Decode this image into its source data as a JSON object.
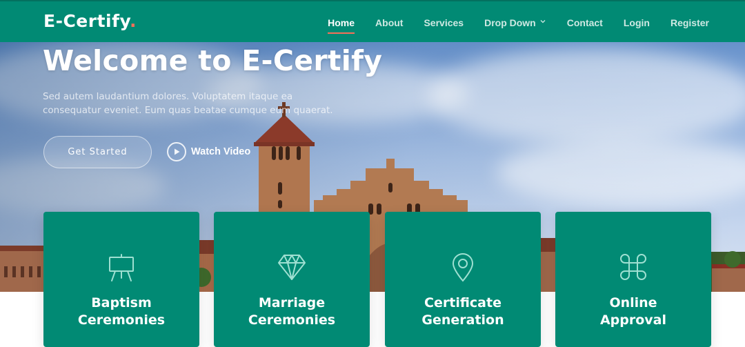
{
  "brand": {
    "name": "E-Certify",
    "dot": ".",
    "accent_color": "#f96f59",
    "primary_color": "#018a74"
  },
  "nav": {
    "items": [
      {
        "label": "Home",
        "active": true
      },
      {
        "label": "About",
        "active": false
      },
      {
        "label": "Services",
        "active": false
      },
      {
        "label": "Drop Down",
        "active": false,
        "has_dropdown": true
      },
      {
        "label": "Contact",
        "active": false
      },
      {
        "label": "Login",
        "active": false
      },
      {
        "label": "Register",
        "active": false
      }
    ]
  },
  "hero": {
    "title": "Welcome to E-Certify",
    "subtitle": "Sed autem laudantium dolores. Voluptatem itaque ea consequatur eveniet. Eum quas beatae cumque eum quaerat.",
    "cta_label": "Get Started",
    "video_label": "Watch Video",
    "video_icon": "play-circle-icon"
  },
  "features": [
    {
      "label": "Baptism\nCeremonies",
      "icon": "easel-icon"
    },
    {
      "label": "Marriage\nCeremonies",
      "icon": "gem-icon"
    },
    {
      "label": "Certificate\nGeneration",
      "icon": "geo-alt-icon"
    },
    {
      "label": "Online\nApproval",
      "icon": "command-icon"
    }
  ]
}
